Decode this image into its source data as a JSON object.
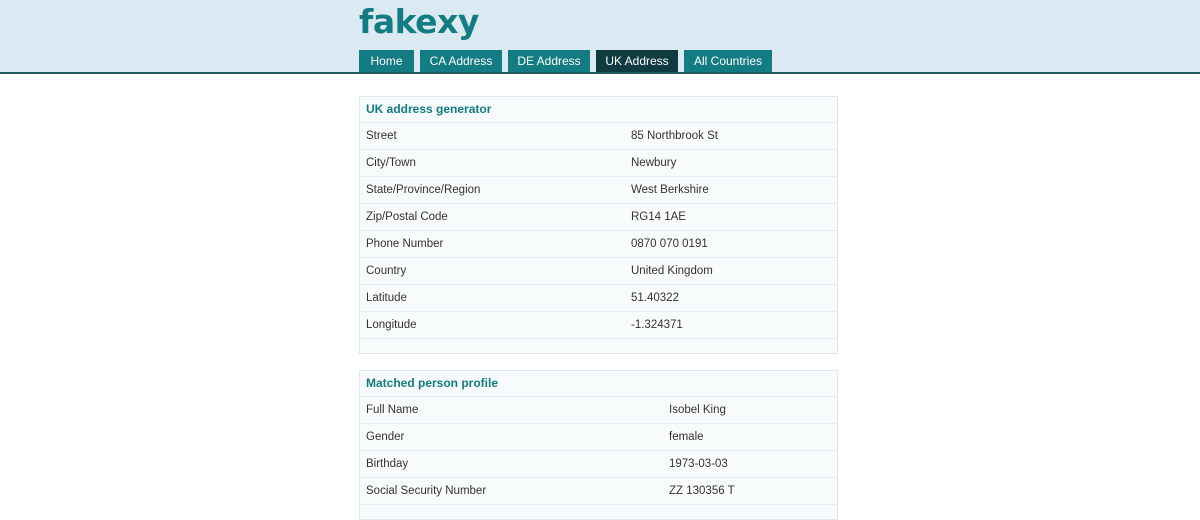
{
  "site": {
    "logo": "fakexy"
  },
  "nav": {
    "tabs": [
      {
        "label": "Home",
        "active": false
      },
      {
        "label": "CA Address",
        "active": false
      },
      {
        "label": "DE Address",
        "active": false
      },
      {
        "label": "UK Address",
        "active": true
      },
      {
        "label": "All Countries",
        "active": false
      }
    ]
  },
  "address_panel": {
    "title": "UK address generator",
    "rows": [
      {
        "label": "Street",
        "value": "85 Northbrook St"
      },
      {
        "label": "City/Town",
        "value": "Newbury"
      },
      {
        "label": "State/Province/Region",
        "value": "West Berkshire"
      },
      {
        "label": "Zip/Postal Code",
        "value": "RG14 1AE"
      },
      {
        "label": "Phone Number",
        "value": "0870 070 0191"
      },
      {
        "label": "Country",
        "value": "United Kingdom"
      },
      {
        "label": "Latitude",
        "value": "51.40322"
      },
      {
        "label": "Longitude",
        "value": "-1.324371"
      }
    ]
  },
  "person_panel": {
    "title": "Matched person profile",
    "rows": [
      {
        "label": "Full Name",
        "value": "Isobel King"
      },
      {
        "label": "Gender",
        "value": "female"
      },
      {
        "label": "Birthday",
        "value": "1973-03-03"
      },
      {
        "label": "Social Security Number",
        "value": "ZZ 130356 T"
      }
    ]
  },
  "colors": {
    "header_bg": "#dbeaf2",
    "accent": "#137c82",
    "active_tab": "#0e3b3f",
    "panel_bg": "#f7fbfc"
  }
}
